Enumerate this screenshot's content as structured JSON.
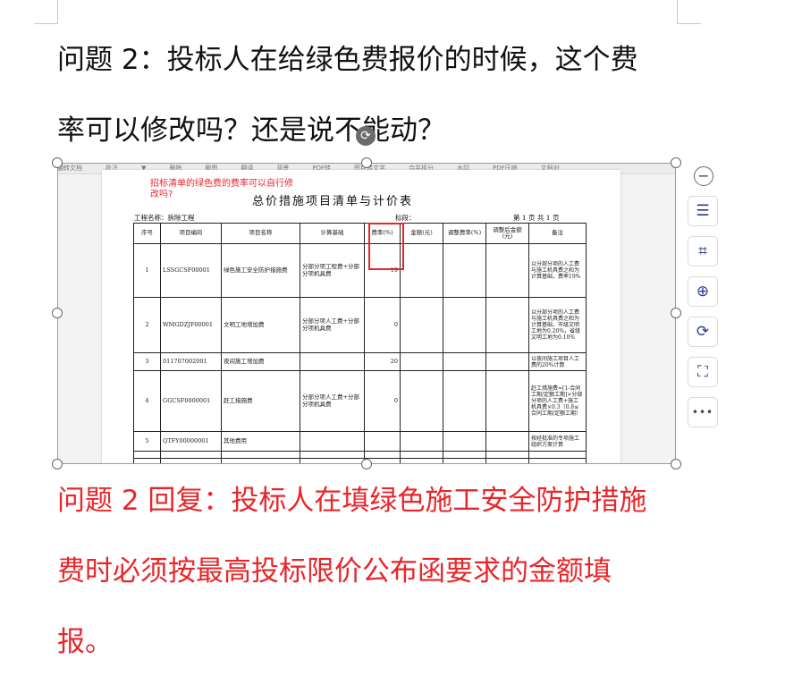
{
  "question": "问题 2：投标人在给绿色费报价的时候，这个费率可以修改吗？还是说不能动？",
  "question_lines": [
    "问题 2：投标人在给绿色费报价的时候，这个费",
    "率可以修改吗？还是说不能动？"
  ],
  "answer_lines": [
    "问题 2 回复：投标人在填绿色施工安全防护措施",
    "费时必须按最高投标限价公布函要求的金额填",
    "报。"
  ],
  "image": {
    "toolbar_items": [
      "翻转文档",
      "批注",
      "▼",
      "删除",
      "截图",
      "翻译",
      "背景",
      "PDF转",
      "图片转文字",
      "合并拆分",
      "水印",
      "PDF压缩",
      "文档对"
    ],
    "note": "招标清单的绿色费的费率可以自行修\n改吗?",
    "table_title": "总价措施项目清单与计价表",
    "project_label": "工程名称：拆除工程",
    "section_label": "标段：",
    "page_label": "第 1 页  共 1 页",
    "headers": [
      "序号",
      "项目编码",
      "项目名称",
      "计算基础",
      "费率(%)",
      "金额(元)",
      "调整费率(%)",
      "调整后金额(元)",
      "备注"
    ],
    "rows": [
      {
        "no": "1",
        "code": "LSSGCSF00001",
        "name": "绿色施工安全防护措施费",
        "base": "分部分项工程费+分部分项机具费",
        "rate": "19",
        "amount": "",
        "adj_rate": "",
        "adj_amount": "",
        "note": "以分部分项的人工费与施工机具费之和为计算基础，费率19%"
      },
      {
        "no": "2",
        "code": "WMGDZJF00001",
        "name": "文明工地增加费",
        "base": "分部分项人工费+分部分项机具费",
        "rate": "0",
        "amount": "",
        "adj_rate": "",
        "adj_amount": "",
        "note": "以分部分项的人工费与施工机具费之和为计算基础，市级文明工地为0.20%，省级文明工地为0.10%"
      },
      {
        "no": "3",
        "code": "011707002001",
        "name": "夜间施工增加费",
        "base": "",
        "rate": "20",
        "amount": "",
        "adj_rate": "",
        "adj_amount": "",
        "note": "以夜间施工项目人工费的20%计算"
      },
      {
        "no": "4",
        "code": "GGCSF0000001",
        "name": "赶工措施费",
        "base": "分部分项人工费+分部分项机具费",
        "rate": "0",
        "amount": "",
        "adj_rate": "",
        "adj_amount": "",
        "note": "赶工措施费=[1-合同工期/定额工期]×分部分项的人工费+施工机具费×0.3（0.8≤合同工期/定额工期）"
      },
      {
        "no": "5",
        "code": "QTFY00000001",
        "name": "其他费用",
        "base": "",
        "rate": "",
        "amount": "",
        "adj_rate": "",
        "adj_amount": "",
        "note": "按经批准的专项施工组织方案计算"
      }
    ]
  },
  "side_toolbar": [
    {
      "name": "minus-icon",
      "glyph": "−"
    },
    {
      "name": "wrap-text-icon",
      "glyph": "☰"
    },
    {
      "name": "crop-icon",
      "glyph": "⌗"
    },
    {
      "name": "zoom-in-icon",
      "glyph": "⊕"
    },
    {
      "name": "rotate-icon",
      "glyph": "⟳"
    },
    {
      "name": "extract-text-icon",
      "glyph": "⛶"
    },
    {
      "name": "more-icon",
      "glyph": "•••"
    }
  ],
  "colors": {
    "answer_text": "#e8262a",
    "question_text": "#111111",
    "icon": "#2b3c8f"
  }
}
